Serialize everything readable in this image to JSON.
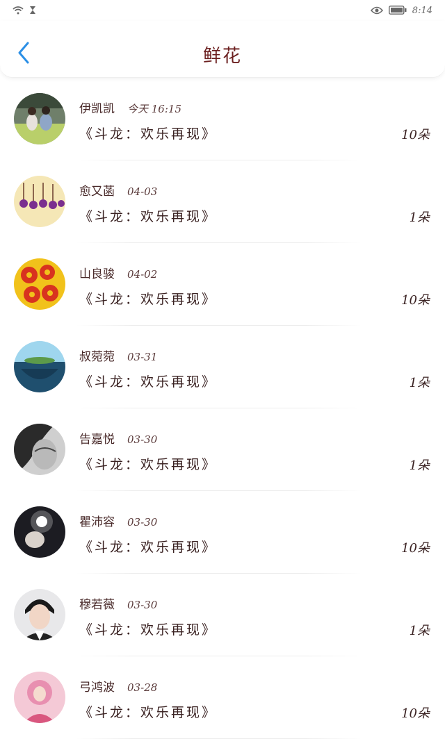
{
  "status_bar": {
    "time": "8:14"
  },
  "header": {
    "title": "鲜花"
  },
  "rows": [
    {
      "name": "伊凯凯",
      "date": "今天 16:15",
      "work": "《斗龙：欢乐再现》",
      "count": "10朵",
      "avatar": "couple-photo"
    },
    {
      "name": "愈又菡",
      "date": "04-03",
      "work": "《斗龙：欢乐再现》",
      "count": "1朵",
      "avatar": "hanging-flowers"
    },
    {
      "name": "山良骏",
      "date": "04-02",
      "work": "《斗龙：欢乐再现》",
      "count": "10朵",
      "avatar": "red-flower-pattern"
    },
    {
      "name": "叔菀菀",
      "date": "03-31",
      "work": "《斗龙：欢乐再现》",
      "count": "1朵",
      "avatar": "island-ocean"
    },
    {
      "name": "告嘉悦",
      "date": "03-30",
      "work": "《斗龙：欢乐再现》",
      "count": "1朵",
      "avatar": "portrait-bw"
    },
    {
      "name": "瞿沛容",
      "date": "03-30",
      "work": "《斗龙：欢乐再现》",
      "count": "10朵",
      "avatar": "night-light"
    },
    {
      "name": "穆若薇",
      "date": "03-30",
      "work": "《斗龙：欢乐再现》",
      "count": "1朵",
      "avatar": "young-man"
    },
    {
      "name": "弓鸿波",
      "date": "03-28",
      "work": "《斗龙：欢乐再现》",
      "count": "10朵",
      "avatar": "pink-girl"
    }
  ],
  "colors": {
    "accent": "#2b8fe6",
    "title": "#6b1f1f"
  }
}
